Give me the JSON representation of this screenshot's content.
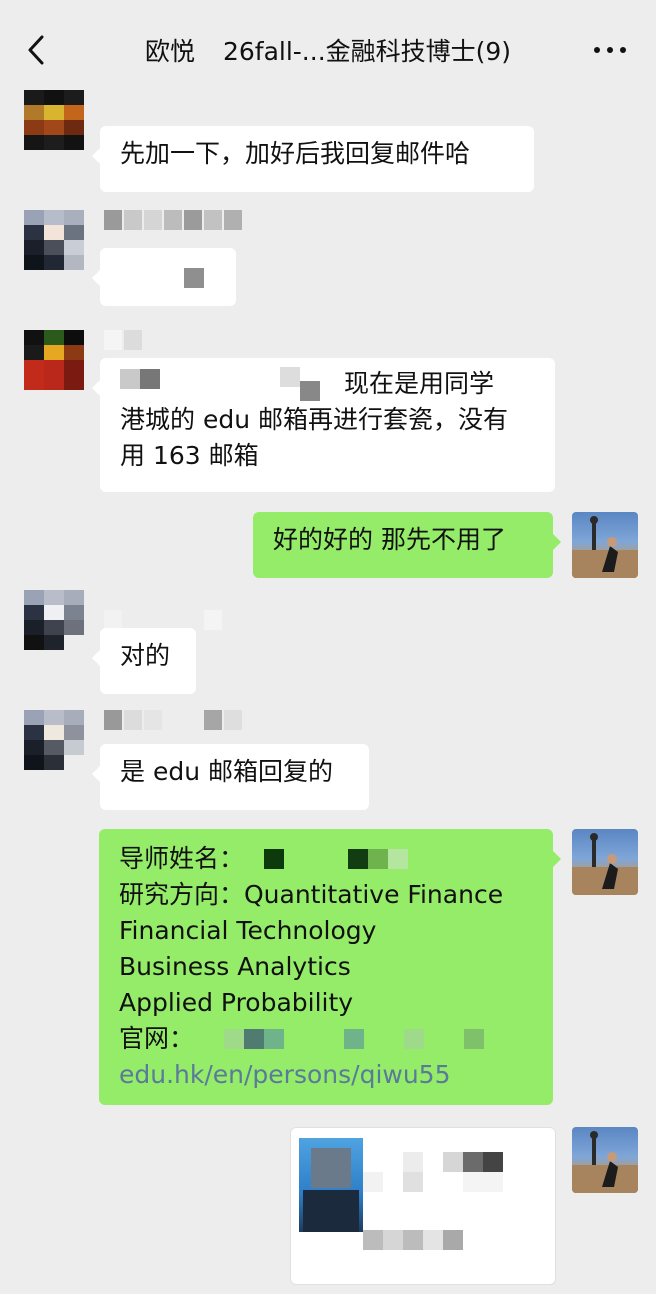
{
  "header": {
    "back_label": "back",
    "contact_name": "欧悦",
    "group_title": "26fall-...金融科技博士(9)",
    "more_label": "more"
  },
  "messages": [
    {
      "from": "other",
      "text": "先加一下，加好后我回复邮件哈"
    },
    {
      "from": "other",
      "text": ""
    },
    {
      "from": "other",
      "lines": [
        "现在是用同学",
        "港城的 edu 邮箱再进行套瓷，没有",
        "用 163 邮箱"
      ]
    },
    {
      "from": "me",
      "text": "好的好的 那先不用了"
    },
    {
      "from": "other",
      "text": "对的"
    },
    {
      "from": "other",
      "text": "是 edu 邮箱回复的"
    },
    {
      "from": "me",
      "lines": {
        "supervisor_label": "导师姓名：",
        "research_label": "研究方向：Quantitative Finance",
        "line3": "Financial Technology",
        "line4": "Business Analytics",
        "line5": "Applied Probability",
        "website_label": "官网：",
        "url_fragment": "edu.hk/en/persons/qiwu55"
      }
    },
    {
      "from": "me",
      "type": "card",
      "text": ""
    }
  ],
  "colors": {
    "background": "#ededed",
    "bubble_in": "#ffffff",
    "bubble_out": "#95ec69",
    "link": "#5a7a9a"
  }
}
